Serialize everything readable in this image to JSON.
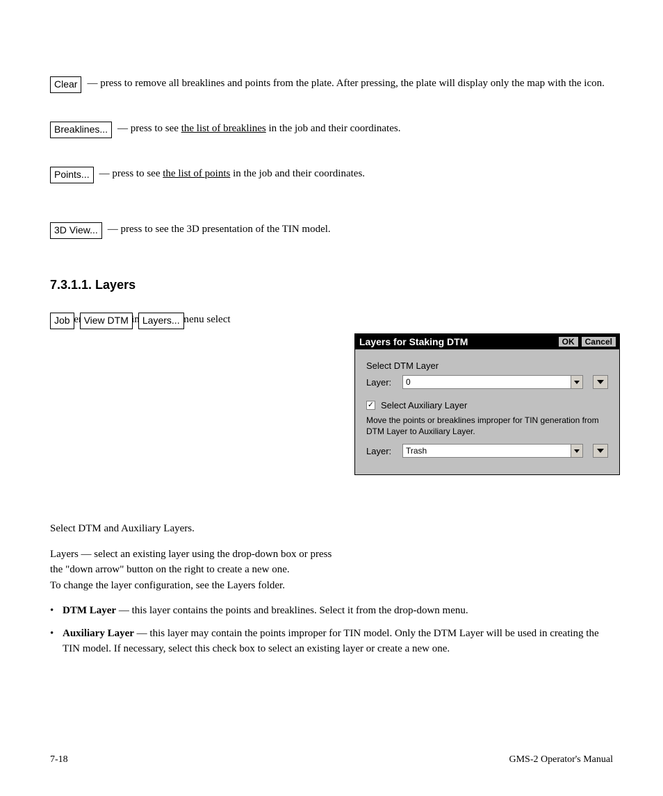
{
  "rows": {
    "clear": {
      "button": "Clear",
      "desc_before": " — press to remove all breaklines and points from the plate. After pressing, the plate will display only the map with the icon."
    },
    "breaklines": {
      "button": "Breaklines...",
      "desc_before": " — press to see ",
      "link": "the list of breaklines",
      "desc_after": " in the job and their coordinates."
    },
    "points": {
      "button": "Points...",
      "desc_before": " — press to see ",
      "link": "the list of points",
      "desc_after": " in the job and their coordinates."
    },
    "threeD": {
      "button": "3D View...",
      "desc": " — press to see the 3D presentation of the TIN model."
    }
  },
  "section": {
    "heading": "7.3.1.1. Layers",
    "path_prefix": "To open the folder, in the main menu select ",
    "path_buttons": [
      "Job",
      "View DTM",
      "Layers..."
    ],
    "path_sep": " / "
  },
  "dialog": {
    "title": "Layers for Staking DTM",
    "ok": "OK",
    "cancel": "Cancel",
    "select_dtm": "Select DTM Layer",
    "layer_label": "Layer:",
    "layer_value_1": "0",
    "aux_checkbox_label": "Select Auxiliary Layer",
    "aux_checked": true,
    "hint": "Move the points or breaklines improper for TIN generation from DTM Layer to Auxiliary Layer.",
    "layer_value_2": "Trash"
  },
  "below": {
    "line1": "Select DTM and Auxiliary Layers.",
    "line2_before": "Layers — select an existing layer using the drop-down box or press",
    "line2_after": "the \"down arrow\" button on the right to create a new one.",
    "line3": "To change the layer configuration, see the Layers folder.",
    "bullet1_strong": "DTM Layer",
    "bullet1_rest": " — this layer contains the points and breaklines. Select it from the drop-down menu.",
    "bullet2_strong": "Auxiliary Layer",
    "bullet2_rest": " — this layer may contain the points improper for TIN model. Only the DTM Layer will be used in creating the TIN model. If necessary, select this check box to select an existing layer or create a new one."
  },
  "footer": {
    "left": "7-18",
    "right": "GMS-2 Operator's Manual"
  }
}
